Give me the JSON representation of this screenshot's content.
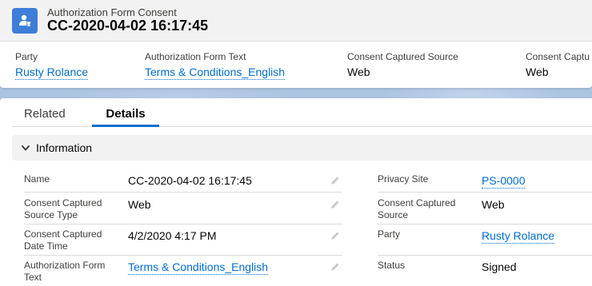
{
  "header": {
    "object_name": "Authorization Form Consent",
    "record_title": "CC-2020-04-02 16:17:45",
    "highlights": [
      {
        "label": "Party",
        "value": "Rusty Rolance",
        "is_link": true
      },
      {
        "label": "Authorization Form Text",
        "value": "Terms & Conditions_English",
        "is_link": true
      },
      {
        "label": "Consent Captured Source",
        "value": "Web",
        "is_link": false
      },
      {
        "label": "Consent Captu",
        "value": "Web",
        "is_link": false
      }
    ]
  },
  "tabs": [
    {
      "label": "Related",
      "active": false
    },
    {
      "label": "Details",
      "active": true
    }
  ],
  "section": {
    "title": "Information"
  },
  "left_fields": [
    {
      "label": "Name",
      "value": "CC-2020-04-02 16:17:45",
      "is_link": false
    },
    {
      "label": "Consent Captured Source Type",
      "value": "Web",
      "is_link": false
    },
    {
      "label": "Consent Captured Date Time",
      "value": "4/2/2020 4:17 PM",
      "is_link": false
    },
    {
      "label": "Authorization Form Text",
      "value": "Terms & Conditions_English",
      "is_link": true
    }
  ],
  "right_fields": [
    {
      "label": "Privacy Site",
      "value": "PS-0000",
      "is_link": true
    },
    {
      "label": "Consent Captured Source",
      "value": "Web",
      "is_link": false
    },
    {
      "label": "Party",
      "value": "Rusty Rolance",
      "is_link": true
    },
    {
      "label": "Status",
      "value": "Signed",
      "is_link": false
    }
  ],
  "colors": {
    "brand_blue": "#0070d2",
    "link": "#006dcc",
    "icon_bg": "#3e7dd8"
  },
  "icons": {
    "record": "authorization-consent-icon",
    "section_toggle": "chevron-down-icon",
    "edit": "pencil-icon"
  }
}
